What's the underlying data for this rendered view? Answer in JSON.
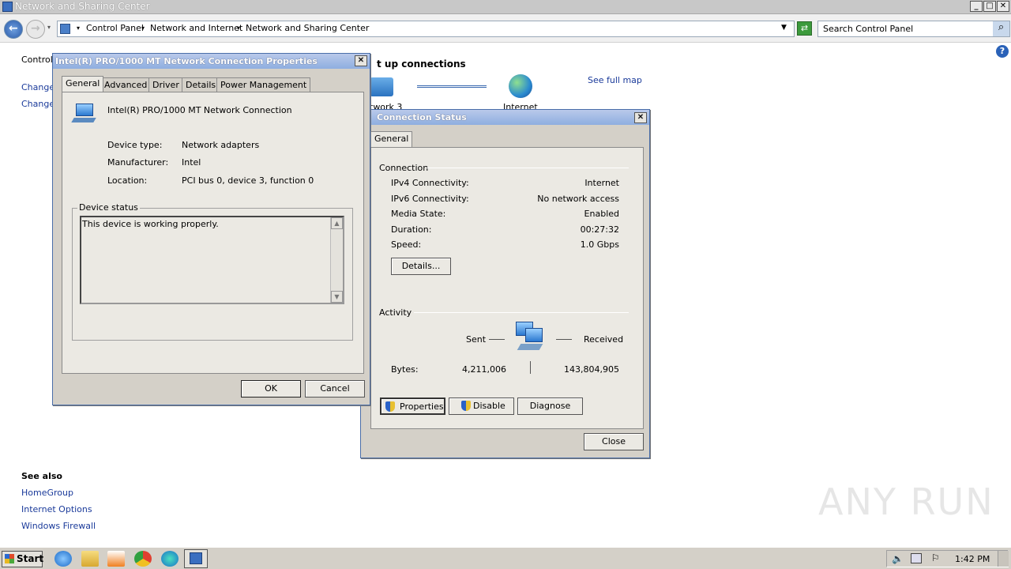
{
  "window": {
    "title": "Network and Sharing Center",
    "controls": [
      "_",
      "□",
      "✕"
    ]
  },
  "address": {
    "breadcrumbs": [
      "Control Panel",
      "Network and Internet",
      "Network and Sharing Center"
    ],
    "search_placeholder": "Search Control Panel"
  },
  "left_panel": {
    "top_links": [
      "Control",
      "Change",
      "Change"
    ],
    "see_also_title": "See also",
    "see_also": [
      "HomeGroup",
      "Internet Options",
      "Windows Firewall"
    ]
  },
  "main": {
    "heading_fragment": "t up connections",
    "see_full_map": "See full map",
    "network_label": "twork  3",
    "internet_label": "Internet"
  },
  "properties_dialog": {
    "title": "Intel(R) PRO/1000 MT Network Connection Properties",
    "tabs": [
      "General",
      "Advanced",
      "Driver",
      "Details",
      "Power Management"
    ],
    "device_name": "Intel(R) PRO/1000 MT Network Connection",
    "fields": [
      {
        "label": "Device type:",
        "value": "Network adapters"
      },
      {
        "label": "Manufacturer:",
        "value": "Intel"
      },
      {
        "label": "Location:",
        "value": "PCI bus 0, device 3, function 0"
      }
    ],
    "status_group": "Device status",
    "status_text": "This device is working properly.",
    "ok": "OK",
    "cancel": "Cancel"
  },
  "status_dialog": {
    "title": "Connection Status",
    "tab": "General",
    "connection_group": "Connection",
    "rows": [
      {
        "label": "IPv4 Connectivity:",
        "value": "Internet"
      },
      {
        "label": "IPv6 Connectivity:",
        "value": "No network access"
      },
      {
        "label": "Media State:",
        "value": "Enabled"
      },
      {
        "label": "Duration:",
        "value": "00:27:32"
      },
      {
        "label": "Speed:",
        "value": "1.0 Gbps"
      }
    ],
    "details_button": "Details...",
    "activity_group": "Activity",
    "sent_label": "Sent",
    "received_label": "Received",
    "bytes_label": "Bytes:",
    "bytes_sent": "4,211,006",
    "bytes_received": "143,804,905",
    "properties_button": "Properties",
    "disable_button": "Disable",
    "diagnose_button": "Diagnose",
    "close_button": "Close"
  },
  "taskbar": {
    "start": "Start",
    "clock": "1:42 PM"
  },
  "watermark": "ANY RUN",
  "colors": {
    "link": "#1a3a9a",
    "dialog_face": "#d4d0c8",
    "title_gradient_top": "#b9c9ea",
    "title_gradient_bottom": "#8eaee0"
  }
}
